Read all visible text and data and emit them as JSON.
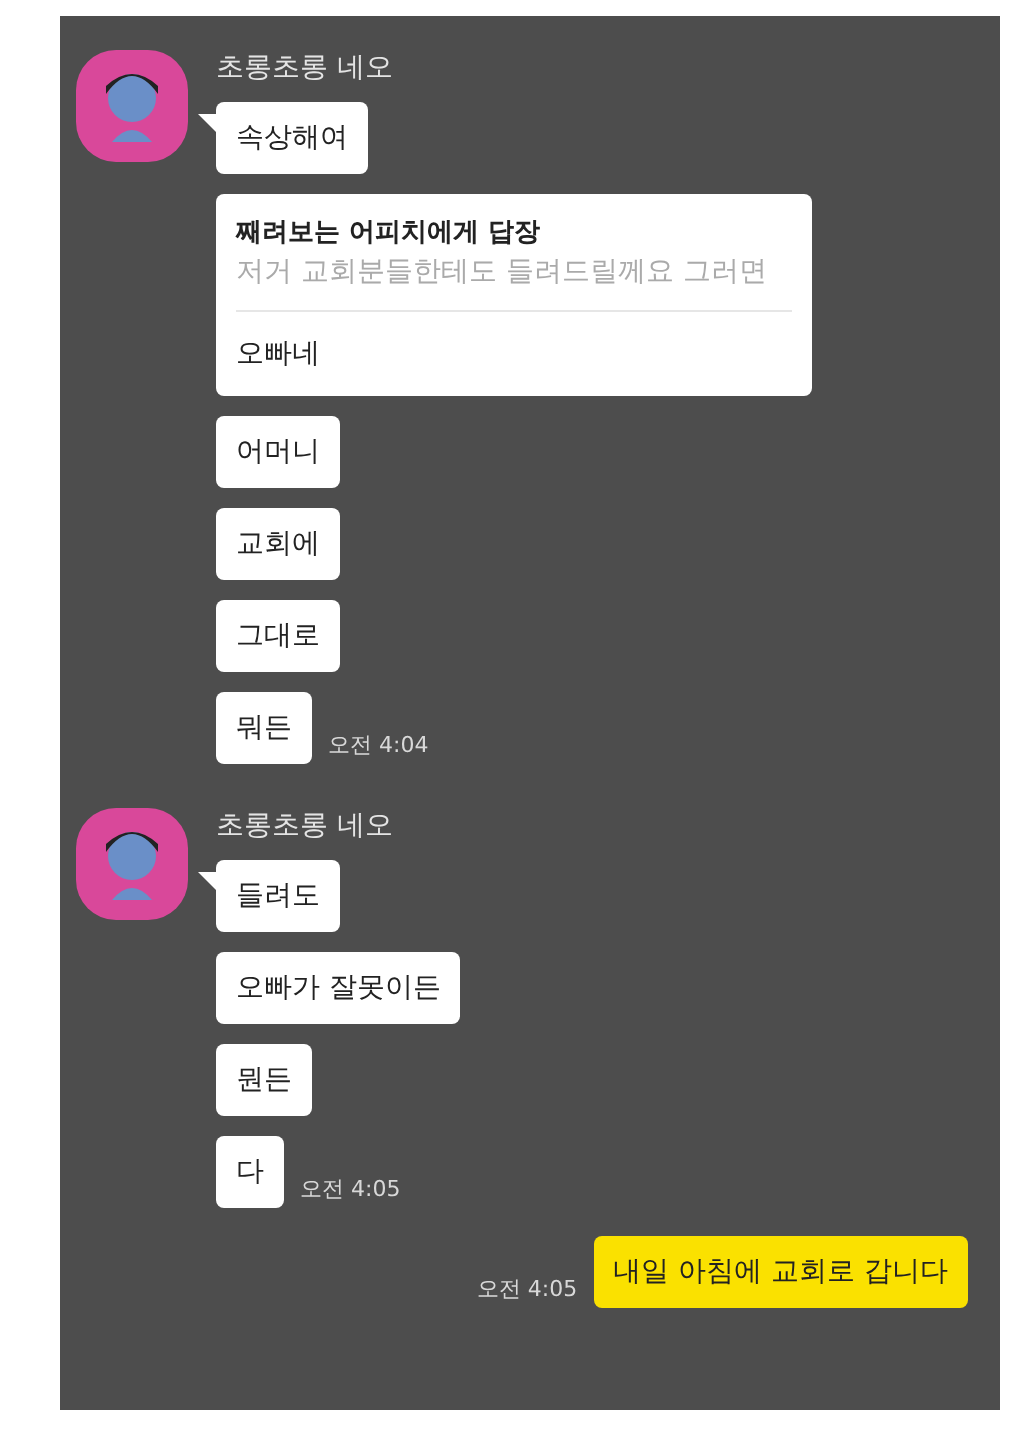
{
  "groups": [
    {
      "kind": "incoming",
      "sender": "초롱초롱 네오",
      "time": "오전 4:04",
      "messages": [
        {
          "kind": "text",
          "text": "속상해여"
        },
        {
          "kind": "reply",
          "reply_to": "째려보는 어피치에게 답장",
          "quote": "저거 교회분들한테도 들려드릴께요 그러면",
          "text": "오빠네"
        },
        {
          "kind": "text",
          "text": "어머니"
        },
        {
          "kind": "text",
          "text": "교회에"
        },
        {
          "kind": "text",
          "text": "그대로"
        },
        {
          "kind": "text",
          "text": "뭐든"
        }
      ]
    },
    {
      "kind": "incoming",
      "sender": "초롱초롱 네오",
      "time": "오전 4:05",
      "messages": [
        {
          "kind": "text",
          "text": "들려도"
        },
        {
          "kind": "text",
          "text": "오빠가 잘못이든"
        },
        {
          "kind": "text",
          "text": "뭔든"
        },
        {
          "kind": "text",
          "text": "다"
        }
      ]
    },
    {
      "kind": "outgoing",
      "time": "오전 4:05",
      "messages": [
        {
          "kind": "text",
          "text": "내일 아침에 교회로 갑니다"
        }
      ]
    }
  ]
}
